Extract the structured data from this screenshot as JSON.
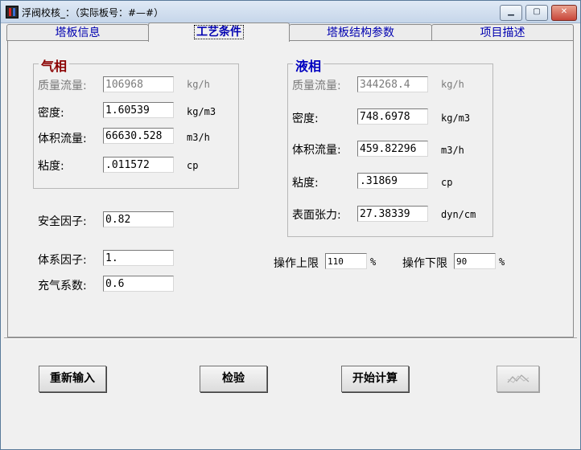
{
  "window": {
    "title": "浮阀校核_：（实际板号：#—#）",
    "min_glyph": "▁",
    "max_glyph": "▢",
    "close_glyph": "✕"
  },
  "tabs": [
    {
      "label": "塔板信息"
    },
    {
      "label": "工艺条件",
      "active": true
    },
    {
      "label": "塔板结构参数"
    },
    {
      "label": "项目描述"
    }
  ],
  "gas": {
    "title": "气相",
    "mass_flow": {
      "label": "质量流量:",
      "value": "106968",
      "unit": "kg/h",
      "enabled": false
    },
    "density": {
      "label": "密度:",
      "value": "1.60539",
      "unit": "kg/m3"
    },
    "volume_flow": {
      "label": "体积流量:",
      "value": "66630.528",
      "unit": "m3/h"
    },
    "viscosity": {
      "label": "粘度:",
      "value": ".011572",
      "unit": "cp"
    }
  },
  "liquid": {
    "title": "液相",
    "mass_flow": {
      "label": "质量流量:",
      "value": "344268.4",
      "unit": "kg/h",
      "enabled": false
    },
    "density": {
      "label": "密度:",
      "value": "748.6978",
      "unit": "kg/m3"
    },
    "volume_flow": {
      "label": "体积流量:",
      "value": "459.82296",
      "unit": "m3/h"
    },
    "viscosity": {
      "label": "粘度:",
      "value": ".31869",
      "unit": "cp"
    },
    "surface_tension": {
      "label": "表面张力:",
      "value": "27.38339",
      "unit": "dyn/cm"
    }
  },
  "factors": {
    "safety": {
      "label": "安全因子:",
      "value": "0.82"
    },
    "system": {
      "label": "体系因子:",
      "value": "1."
    },
    "aeration": {
      "label": "充气系数:",
      "value": "0.6"
    }
  },
  "operation": {
    "upper": {
      "label": "操作上限",
      "value": "110",
      "unit": "%"
    },
    "lower": {
      "label": "操作下限",
      "value": "90",
      "unit": "%"
    }
  },
  "buttons": {
    "reset": "重新输入",
    "check": "检验",
    "calculate": "开始计算",
    "chart_icon": "line-chart-icon"
  },
  "colors": {
    "gas_title": "#8b0000",
    "liquid_title": "#0000c0",
    "tab_text": "#0000b0"
  }
}
